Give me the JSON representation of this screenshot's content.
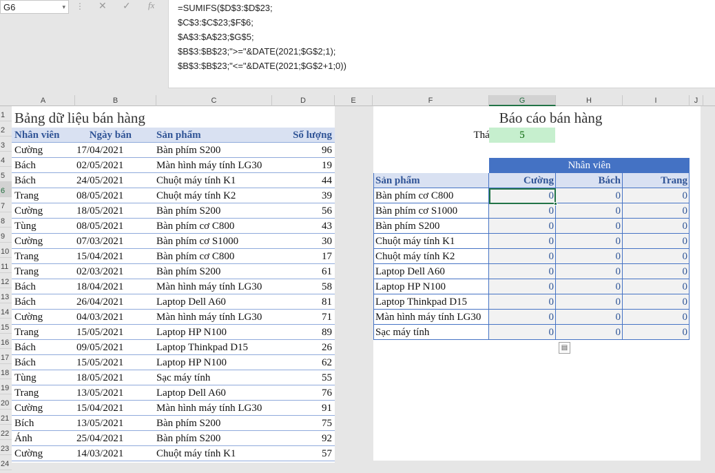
{
  "formula_bar": {
    "name_box": "G6",
    "name_box_arrow": "▾",
    "dots": "⋮",
    "cancel_glyph": "✕",
    "enter_glyph": "✓",
    "fx_glyph": "fx",
    "formula_lines": [
      "=SUMIFS($D$3:$D$23;",
      "$C$3:$C$23;$F$6;",
      "$A$3:$A$23;$G$5;",
      "$B$3:$B$23;\">=\"&DATE(2021;$G$2;1);",
      "$B$3:$B$23;\"<=\"&DATE(2021;$G$2+1;0))"
    ]
  },
  "columns": [
    "A",
    "B",
    "C",
    "D",
    "E",
    "F",
    "G",
    "H",
    "I",
    "J"
  ],
  "selected_column": "G",
  "rows": [
    "1",
    "2",
    "3",
    "4",
    "5",
    "6",
    "7",
    "8",
    "9",
    "10",
    "11",
    "12",
    "13",
    "14",
    "15",
    "16",
    "17",
    "18",
    "19",
    "20",
    "21",
    "22",
    "23",
    "24"
  ],
  "selected_row": "6",
  "data_table": {
    "title": "Bảng dữ liệu bán hàng",
    "headers": [
      "Nhân viên",
      "Ngày bán",
      "Sản phẩm",
      "Số lượng"
    ],
    "rows": [
      [
        "Cường",
        "17/04/2021",
        "Bàn phím S200",
        "96"
      ],
      [
        "Bách",
        "02/05/2021",
        "Màn hình máy tính LG30",
        "19"
      ],
      [
        "Bách",
        "24/05/2021",
        "Chuột máy tính K1",
        "44"
      ],
      [
        "Trang",
        "08/05/2021",
        "Chuột máy tính K2",
        "39"
      ],
      [
        "Cường",
        "18/05/2021",
        "Bàn phím S200",
        "56"
      ],
      [
        "Tùng",
        "08/05/2021",
        "Bàn phím cơ C800",
        "43"
      ],
      [
        "Cường",
        "07/03/2021",
        "Bàn phím cơ S1000",
        "30"
      ],
      [
        "Trang",
        "15/04/2021",
        "Bàn phím cơ C800",
        "17"
      ],
      [
        "Trang",
        "02/03/2021",
        "Bàn phím S200",
        "61"
      ],
      [
        "Bách",
        "18/04/2021",
        "Màn hình máy tính LG30",
        "58"
      ],
      [
        "Bách",
        "26/04/2021",
        "Laptop Dell A60",
        "81"
      ],
      [
        "Cường",
        "04/03/2021",
        "Màn hình máy tính LG30",
        "71"
      ],
      [
        "Trang",
        "15/05/2021",
        "Laptop HP N100",
        "89"
      ],
      [
        "Bách",
        "09/05/2021",
        "Laptop Thinkpad D15",
        "26"
      ],
      [
        "Bách",
        "15/05/2021",
        "Laptop HP N100",
        "62"
      ],
      [
        "Tùng",
        "18/05/2021",
        "Sạc máy tính",
        "55"
      ],
      [
        "Trang",
        "13/05/2021",
        "Laptop Dell A60",
        "76"
      ],
      [
        "Cường",
        "15/04/2021",
        "Màn hình máy tính LG30",
        "91"
      ],
      [
        "Bích",
        "13/05/2021",
        "Bàn phím S200",
        "75"
      ],
      [
        "Ánh",
        "25/04/2021",
        "Bàn phím S200",
        "92"
      ],
      [
        "Cường",
        "14/03/2021",
        "Chuột máy tính K1",
        "57"
      ]
    ]
  },
  "report": {
    "title": "Báo cáo bán hàng",
    "month_label": "Tháng:",
    "month_value": "5",
    "employee_header": "Nhân viên",
    "product_header": "Sản phẩm",
    "employees": [
      "Cường",
      "Bách",
      "Trang"
    ],
    "rows": [
      {
        "product": "Bàn phím cơ C800",
        "values": [
          "0",
          "0",
          "0"
        ]
      },
      {
        "product": "Bàn phím cơ S1000",
        "values": [
          "0",
          "0",
          "0"
        ]
      },
      {
        "product": "Bàn phím S200",
        "values": [
          "0",
          "0",
          "0"
        ]
      },
      {
        "product": "Chuột máy tính K1",
        "values": [
          "0",
          "0",
          "0"
        ]
      },
      {
        "product": "Chuột máy tính K2",
        "values": [
          "0",
          "0",
          "0"
        ]
      },
      {
        "product": "Laptop Dell A60",
        "values": [
          "0",
          "0",
          "0"
        ]
      },
      {
        "product": "Laptop HP N100",
        "values": [
          "0",
          "0",
          "0"
        ]
      },
      {
        "product": "Laptop Thinkpad D15",
        "values": [
          "0",
          "0",
          "0"
        ]
      },
      {
        "product": "Màn hình máy tính LG30",
        "values": [
          "0",
          "0",
          "0"
        ]
      },
      {
        "product": "Sạc máy tính",
        "values": [
          "0",
          "0",
          "0"
        ]
      }
    ],
    "paste_options_glyph": "▤"
  }
}
